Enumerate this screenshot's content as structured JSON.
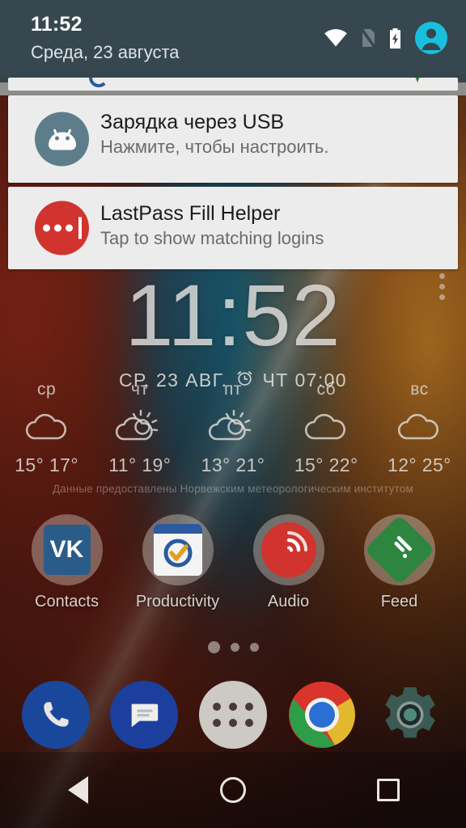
{
  "theme": {
    "statusbar_bg": "#37474f",
    "notification_bg": "#ececec",
    "accent_cyan": "#19c0dd",
    "lastpass_red": "#d1332e",
    "usb_icon_bg": "#5e7d8a",
    "wallpaper_colors": [
      "#962816",
      "#166e8c",
      "#e19628",
      "#3a1a12"
    ]
  },
  "statusbar": {
    "time": "11:52",
    "date": "Среда, 23 августа",
    "icons": [
      "wifi-icon",
      "no-sim-icon",
      "battery-charging-icon",
      "user-avatar-icon"
    ]
  },
  "shade": {
    "notifications": [
      {
        "id": "usb-charging",
        "icon": "android-robot-head-icon",
        "title": "Зарядка через USB",
        "text": "Нажмите, чтобы настроить."
      },
      {
        "id": "lastpass-fill-helper",
        "icon": "lastpass-dots-icon",
        "title": "LastPass Fill Helper",
        "text": "Tap to show matching logins"
      }
    ]
  },
  "clock_widget": {
    "time": "11:52",
    "date": "СР, 23 АВГ.",
    "alarm_icon": "alarm-clock-icon",
    "alarm": "ЧТ 07:00",
    "overflow_icon": "more-vertical-icon"
  },
  "weather_widget": {
    "days": [
      {
        "name": "ср",
        "icon": "cloud-icon",
        "temp": "15° 17°",
        "low": "15°",
        "high": "17°"
      },
      {
        "name": "чт",
        "icon": "partly-sunny-icon",
        "temp": "11° 19°",
        "low": "11°",
        "high": "19°"
      },
      {
        "name": "пт",
        "icon": "partly-sunny-icon",
        "temp": "13° 21°",
        "low": "13°",
        "high": "21°"
      },
      {
        "name": "сб",
        "icon": "cloud-icon",
        "temp": "15° 22°",
        "low": "15°",
        "high": "22°"
      },
      {
        "name": "вс",
        "icon": "cloud-icon",
        "temp": "12° 25°",
        "low": "12°",
        "high": "25°"
      }
    ],
    "credit": "Данные предоставлены Норвежским метеорологическим институтом"
  },
  "folders": [
    {
      "label": "Contacts",
      "icon": "vk-folder-icon",
      "glyph": "VK"
    },
    {
      "label": "Productivity",
      "icon": "calendar-check-folder-icon"
    },
    {
      "label": "Audio",
      "icon": "pocketcasts-folder-icon"
    },
    {
      "label": "Feed",
      "icon": "feedly-folder-icon"
    }
  ],
  "page_indicator": {
    "total": 3,
    "active": 1
  },
  "dock": [
    {
      "name": "phone",
      "icon": "phone-icon"
    },
    {
      "name": "messages",
      "icon": "message-icon"
    },
    {
      "name": "app-drawer",
      "icon": "app-drawer-icon"
    },
    {
      "name": "chrome",
      "icon": "chrome-icon"
    },
    {
      "name": "settings",
      "icon": "gear-icon"
    }
  ],
  "navbar": [
    {
      "name": "back",
      "icon": "back-triangle-icon"
    },
    {
      "name": "home",
      "icon": "home-circle-icon"
    },
    {
      "name": "recents",
      "icon": "recents-square-icon"
    }
  ]
}
